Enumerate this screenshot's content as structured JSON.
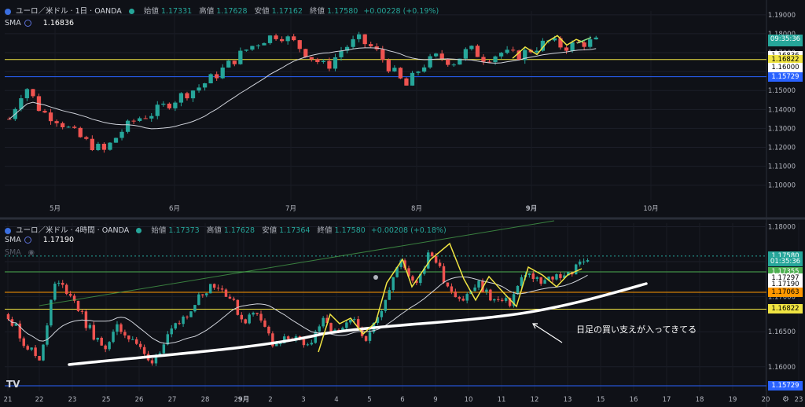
{
  "top": {
    "symbol": "ユーロ／米ドル · 1日 · OANDA",
    "open_label": "始値",
    "open": "1.17331",
    "high_label": "高値",
    "high": "1.17628",
    "low_label": "安値",
    "low": "1.17162",
    "close_label": "終値",
    "close": "1.17580",
    "change": "+0.00228 (+0.19%)",
    "sma_label": "SMA",
    "sma_value": "1.16836",
    "price_tags": [
      {
        "text": "1.17580",
        "price": 1.1758,
        "bg": "#26a69a",
        "fg": "#ffffff"
      },
      {
        "text": "09:35:36",
        "price": 1.17725,
        "bg": "#26a69a",
        "fg": "#ffffff"
      },
      {
        "text": "1.16836",
        "price": 1.16836,
        "bg": "#ffffff",
        "fg": "#000000"
      },
      {
        "text": "1.16822",
        "price": 1.1664,
        "bg": "#f0e442",
        "fg": "#000000"
      },
      {
        "text": "1.16000",
        "price": 1.162,
        "bg": "#ffffff",
        "fg": "#000000"
      },
      {
        "text": "1.15729",
        "price": 1.15729,
        "bg": "#2962ff",
        "fg": "#ffffff"
      }
    ]
  },
  "bottom": {
    "symbol": "ユーロ／米ドル · 4時間 · OANDA",
    "open_label": "始値",
    "open": "1.17373",
    "high_label": "高値",
    "high": "1.17628",
    "low_label": "安値",
    "low": "1.17364",
    "close_label": "終値",
    "close": "1.17580",
    "change": "+0.00208 (+0.18%)",
    "sma_label": "SMA",
    "sma_value": "1.17190",
    "sma2_label": "SMA",
    "price_tags": [
      {
        "text": "1.17580",
        "price": 1.1758,
        "bg": "#26a69a",
        "fg": "#ffffff"
      },
      {
        "text": "01:35:36",
        "price": 1.17505,
        "bg": "#26a69a",
        "fg": "#ffffff"
      },
      {
        "text": "1.17355",
        "price": 1.17355,
        "bg": "#4caf50",
        "fg": "#ffffff"
      },
      {
        "text": "1.17297",
        "price": 1.17265,
        "bg": "#ffffff",
        "fg": "#000000"
      },
      {
        "text": "1.17190",
        "price": 1.17175,
        "bg": "#ffffff",
        "fg": "#000000"
      },
      {
        "text": "1.17063",
        "price": 1.17063,
        "bg": "#ff9800",
        "fg": "#000000"
      },
      {
        "text": "1.16822",
        "price": 1.16822,
        "bg": "#f0e442",
        "fg": "#000000"
      },
      {
        "text": "1.15729",
        "price": 1.15729,
        "bg": "#2962ff",
        "fg": "#ffffff"
      }
    ],
    "annotation": "日足の買い支えが入ってきてる"
  },
  "chart_data": [
    {
      "type": "candlestick",
      "title": "ユーロ／米ドル · 1日 · OANDA",
      "x_ticks": [
        "5月",
        "6月",
        "7月",
        "8月",
        "9月",
        "10月"
      ],
      "y_ticks": [
        "1.19000",
        "1.18000",
        "1.17000",
        "1.16000",
        "1.15000",
        "1.14000",
        "1.13000",
        "1.12000",
        "1.11000",
        "1.10000"
      ],
      "ylim": [
        1.092,
        1.192
      ],
      "horizontal_lines": [
        {
          "price": 1.1664,
          "color": "#f0e442"
        },
        {
          "price": 1.15729,
          "color": "#2962ff"
        }
      ],
      "close_path": [
        1.135,
        1.153,
        1.139,
        1.135,
        1.128,
        1.122,
        1.118,
        1.128,
        1.135,
        1.138,
        1.143,
        1.148,
        1.152,
        1.158,
        1.165,
        1.172,
        1.177,
        1.18,
        1.175,
        1.168,
        1.162,
        1.172,
        1.177,
        1.172,
        1.162,
        1.152,
        1.163,
        1.168,
        1.165,
        1.172,
        1.167,
        1.17,
        1.168,
        1.172,
        1.176,
        1.173,
        1.175,
        1.1758
      ],
      "candle_count": 100
    },
    {
      "type": "candlestick",
      "title": "ユーロ／米ドル · 4時間 · OANDA",
      "x_ticks": [
        "21",
        "22",
        "23",
        "25",
        "26",
        "27",
        "28",
        "29",
        "9月",
        "2",
        "3",
        "4",
        "5",
        "6",
        "9",
        "10",
        "11",
        "12",
        "13",
        "15",
        "16",
        "17",
        "18",
        "19",
        "20",
        "23"
      ],
      "y_ticks": [
        "1.18000",
        "1.17500",
        "1.17000",
        "1.16500",
        "1.16000"
      ],
      "ylim": [
        1.1565,
        1.1805
      ],
      "horizontal_lines": [
        {
          "price": 1.1758,
          "color": "#26a69a"
        },
        {
          "price": 1.17355,
          "color": "#4caf50"
        },
        {
          "price": 1.17063,
          "color": "#ff9800"
        },
        {
          "price": 1.16822,
          "color": "#f0e442"
        },
        {
          "price": 1.15729,
          "color": "#2962ff"
        }
      ],
      "close_path": [
        1.1675,
        1.1635,
        1.161,
        1.172,
        1.1705,
        1.166,
        1.1625,
        1.1655,
        1.164,
        1.1605,
        1.1635,
        1.1665,
        1.1695,
        1.172,
        1.1705,
        1.1665,
        1.168,
        1.1625,
        1.1645,
        1.1625,
        1.1665,
        1.1645,
        1.1665,
        1.164,
        1.1695,
        1.175,
        1.172,
        1.1765,
        1.1718,
        1.1695,
        1.1718,
        1.1695,
        1.169,
        1.1735,
        1.1718,
        1.173,
        1.1735,
        1.1758
      ],
      "candle_count": 150
    }
  ]
}
